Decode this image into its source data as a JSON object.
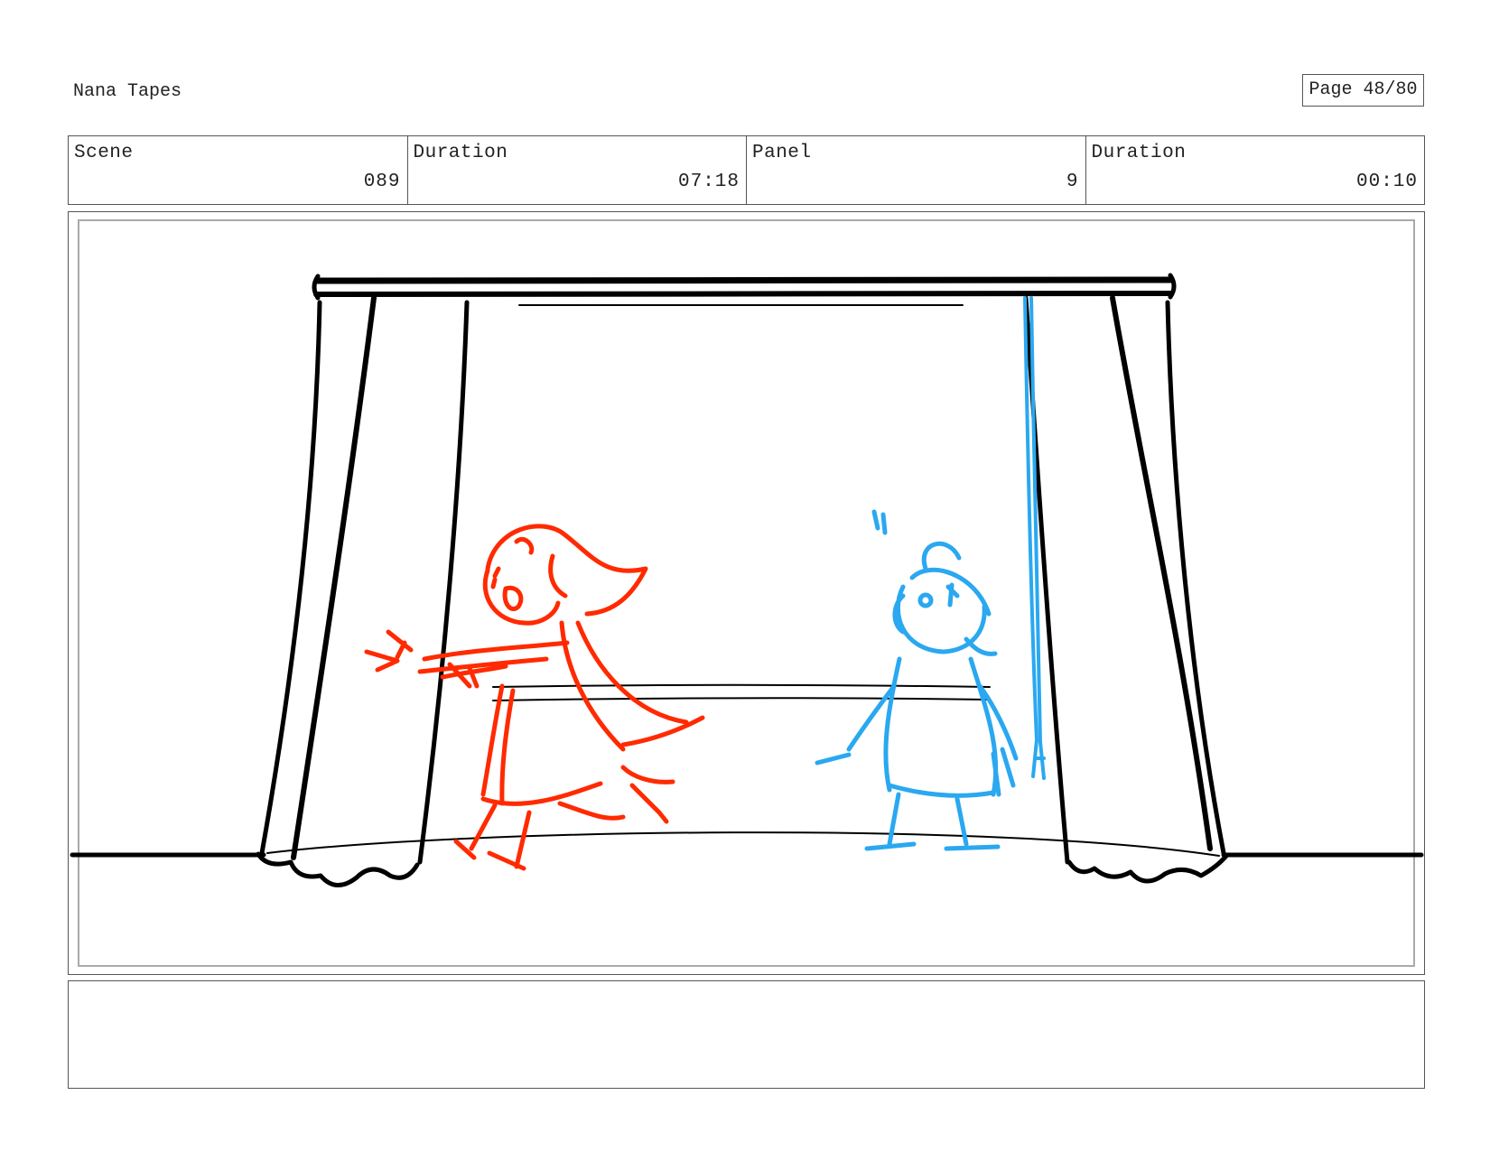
{
  "header": {
    "project_title": "Nana Tapes",
    "page_label": "Page 48/80"
  },
  "info": {
    "scene_label": "Scene",
    "scene_value": "089",
    "scene_duration_label": "Duration",
    "scene_duration_value": "07:18",
    "panel_label": "Panel",
    "panel_value": "9",
    "panel_duration_label": "Duration",
    "panel_duration_value": "00:10"
  },
  "panel": {
    "description": "Stage with curtains; red girl on the left, blue character on the right.",
    "colors": {
      "ink": "#000000",
      "red_character": "#ff2a00",
      "blue_character": "#2aa8f0"
    }
  },
  "notes": {
    "text": ""
  }
}
